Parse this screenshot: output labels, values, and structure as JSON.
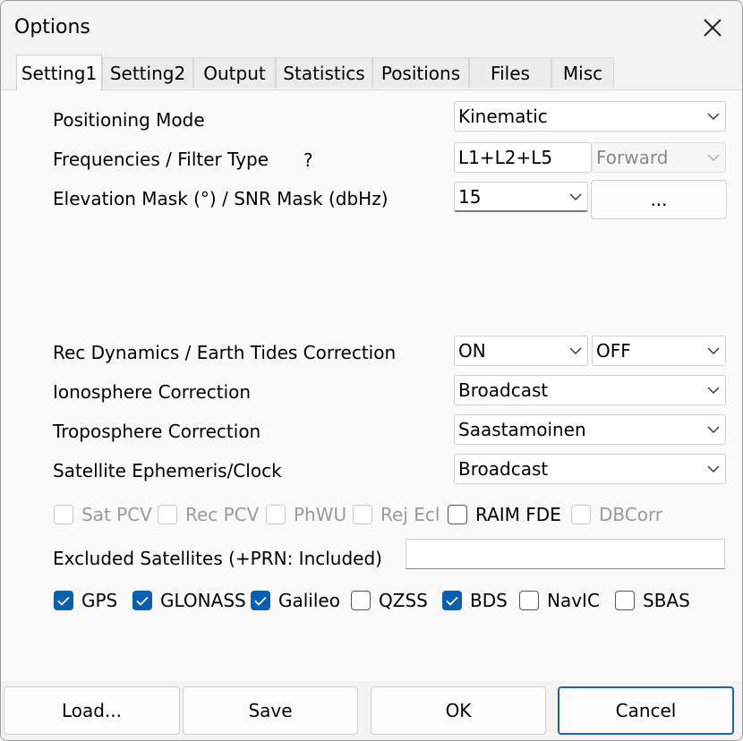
{
  "window": {
    "title": "Options"
  },
  "tabs": [
    {
      "label": "Setting1"
    },
    {
      "label": "Setting2"
    },
    {
      "label": "Output"
    },
    {
      "label": "Statistics"
    },
    {
      "label": "Positions"
    },
    {
      "label": "Files"
    },
    {
      "label": "Misc"
    }
  ],
  "labels": {
    "positioning_mode": "Positioning Mode",
    "freq_filter": "Frequencies / Filter Type",
    "help_mark": "?",
    "elev_snr": "Elevation Mask (°) / SNR Mask (dbHz)",
    "rec_dyn_tides": "Rec Dynamics / Earth Tides Correction",
    "iono": "Ionosphere Correction",
    "tropo": "Troposphere Correction",
    "ephem": "Satellite Ephemeris/Clock",
    "excluded": "Excluded Satellites (+PRN: Included)"
  },
  "combos": {
    "positioning_mode": "Kinematic",
    "frequencies": "L1+L2+L5",
    "filter_type": "Forward",
    "elevation_mask": "15",
    "snr_button": "...",
    "rec_dynamics": "ON",
    "earth_tides": "OFF",
    "ionosphere": "Broadcast",
    "troposphere": "Saastamoinen",
    "ephemeris": "Broadcast"
  },
  "options_checks": [
    {
      "label": "Sat PCV",
      "checked": false,
      "enabled": false
    },
    {
      "label": "Rec PCV",
      "checked": false,
      "enabled": false
    },
    {
      "label": "PhWU",
      "checked": false,
      "enabled": false
    },
    {
      "label": "Rej Ecl",
      "checked": false,
      "enabled": false
    },
    {
      "label": "RAIM FDE",
      "checked": false,
      "enabled": true
    },
    {
      "label": "DBCorr",
      "checked": false,
      "enabled": false
    }
  ],
  "excluded_value": "",
  "constellations": [
    {
      "label": "GPS",
      "checked": true
    },
    {
      "label": "GLONASS",
      "checked": true
    },
    {
      "label": "Galileo",
      "checked": true
    },
    {
      "label": "QZSS",
      "checked": false
    },
    {
      "label": "BDS",
      "checked": true
    },
    {
      "label": "NavIC",
      "checked": false
    },
    {
      "label": "SBAS",
      "checked": false
    }
  ],
  "buttons": {
    "load": "Load...",
    "save": "Save",
    "ok": "OK",
    "cancel": "Cancel"
  },
  "colors": {
    "checkbox_accent": "#0a5fb3",
    "default_button_border": "#1d5fb3"
  }
}
